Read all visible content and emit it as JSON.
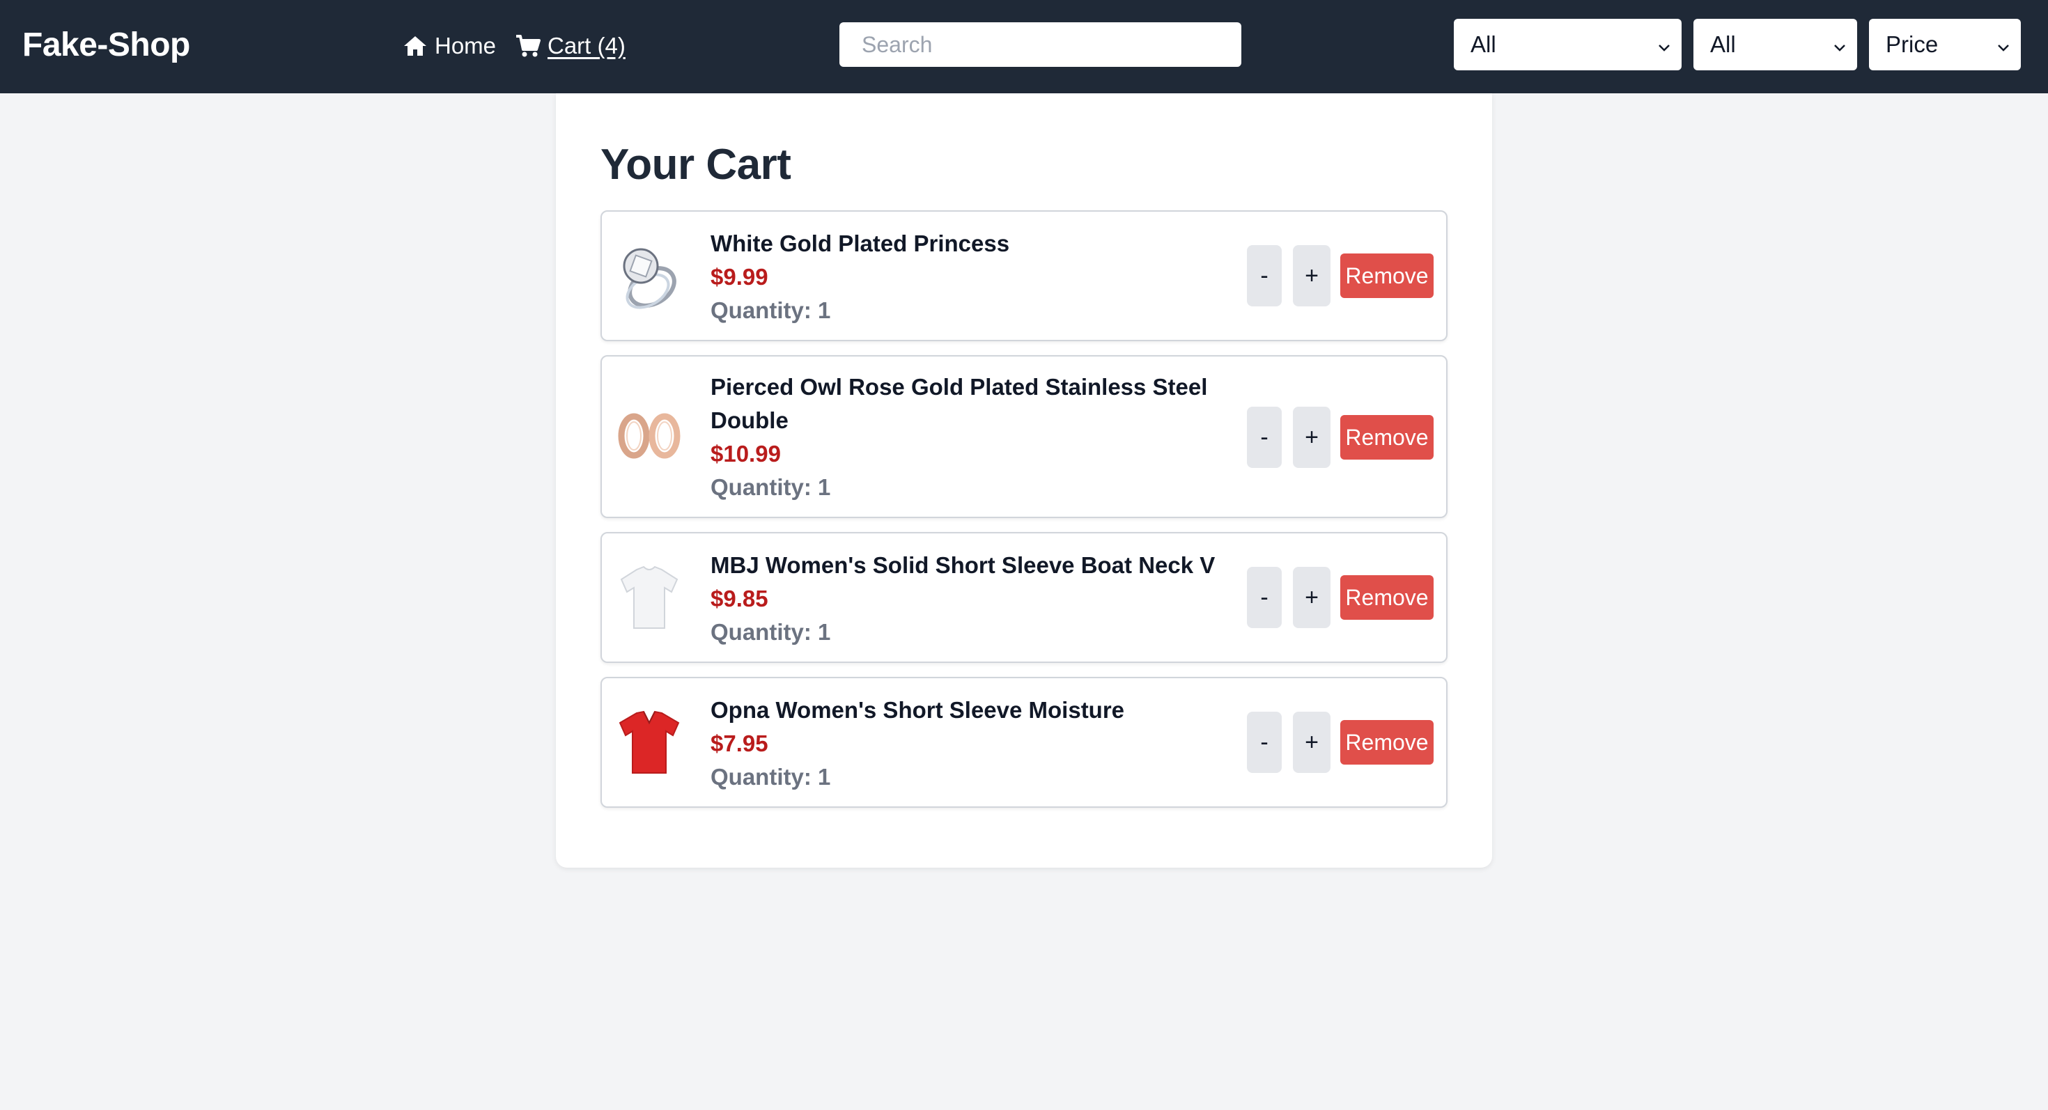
{
  "navbar": {
    "brand": "Fake-Shop",
    "home_label": "Home",
    "cart_label": "Cart (4)",
    "search_placeholder": "Search",
    "search_value": "",
    "filter_category": "All",
    "filter_second": "All",
    "sort_select": "Price",
    "bg_color": "#1f2937"
  },
  "cart": {
    "title": "Your Cart",
    "minus_label": "-",
    "plus_label": "+",
    "remove_label": "Remove",
    "items": [
      {
        "title": "White Gold Plated Princess",
        "price": "$9.99",
        "quantity": "Quantity: 1",
        "image_icon": "ring-icon"
      },
      {
        "title": "Pierced Owl Rose Gold Plated Stainless Steel Double",
        "price": "$10.99",
        "quantity": "Quantity: 1",
        "image_icon": "rings-icon"
      },
      {
        "title": "MBJ Women's Solid Short Sleeve Boat Neck V",
        "price": "$9.85",
        "quantity": "Quantity: 1",
        "image_icon": "white-tshirt-icon"
      },
      {
        "title": "Opna Women's Short Sleeve Moisture",
        "price": "$7.95",
        "quantity": "Quantity: 1",
        "image_icon": "red-tshirt-icon"
      }
    ]
  },
  "colors": {
    "price": "#b91c1c",
    "remove_button": "#e04f4a",
    "quantity_text": "#6b7280",
    "page_background": "#f3f4f6"
  }
}
